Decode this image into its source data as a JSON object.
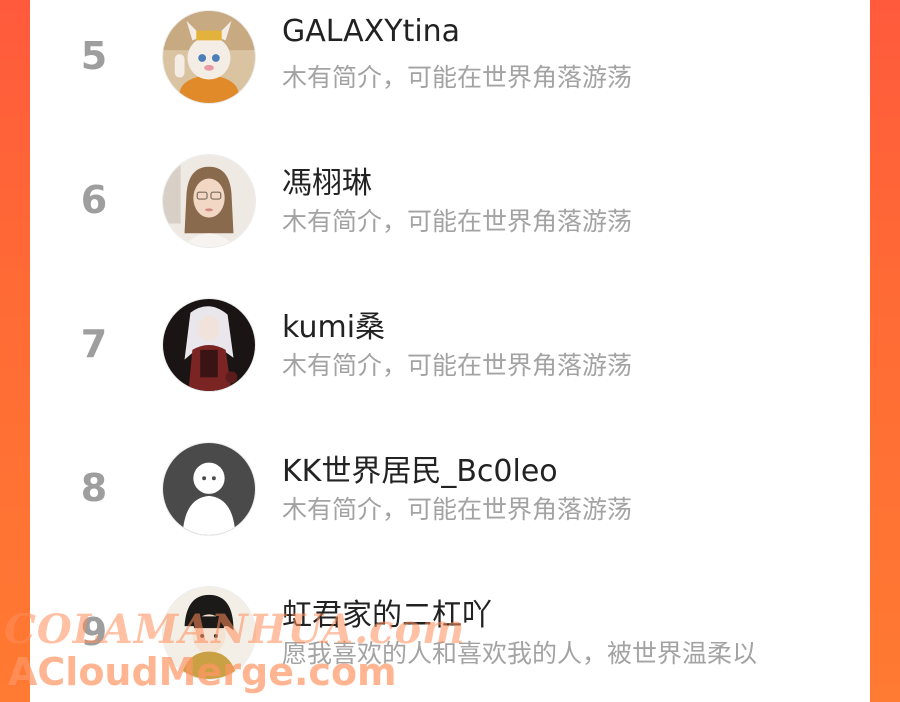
{
  "users": [
    {
      "rank": "5",
      "name": "GALAXYtina",
      "bio": "木有简介，可能在世界角落游荡",
      "avatar": "mascot-avatar-icon"
    },
    {
      "rank": "6",
      "name": "馮栩琳",
      "bio": "木有简介，可能在世界角落游荡",
      "avatar": "woman-photo-avatar-icon"
    },
    {
      "rank": "7",
      "name": "kumi桑",
      "bio": "木有简介，可能在世界角落游荡",
      "avatar": "anime-girl-avatar-icon"
    },
    {
      "rank": "8",
      "name": "KK世界居民_Bc0leo",
      "bio": "木有简介，可能在世界角落游荡",
      "avatar": "default-user-avatar-icon"
    },
    {
      "rank": "9",
      "name": "虹君家的二杠吖",
      "bio": "愿我喜欢的人和喜欢我的人，被世界温柔以",
      "avatar": "anime-boy-avatar-icon"
    }
  ],
  "watermark": {
    "line1": "COLAMANHUA.com",
    "line2": "ACloudMerge.com"
  },
  "colors": {
    "accent": "#ff6a35",
    "rank": "#9e9e9e",
    "name": "#222222",
    "bio": "#a3a3a3"
  }
}
